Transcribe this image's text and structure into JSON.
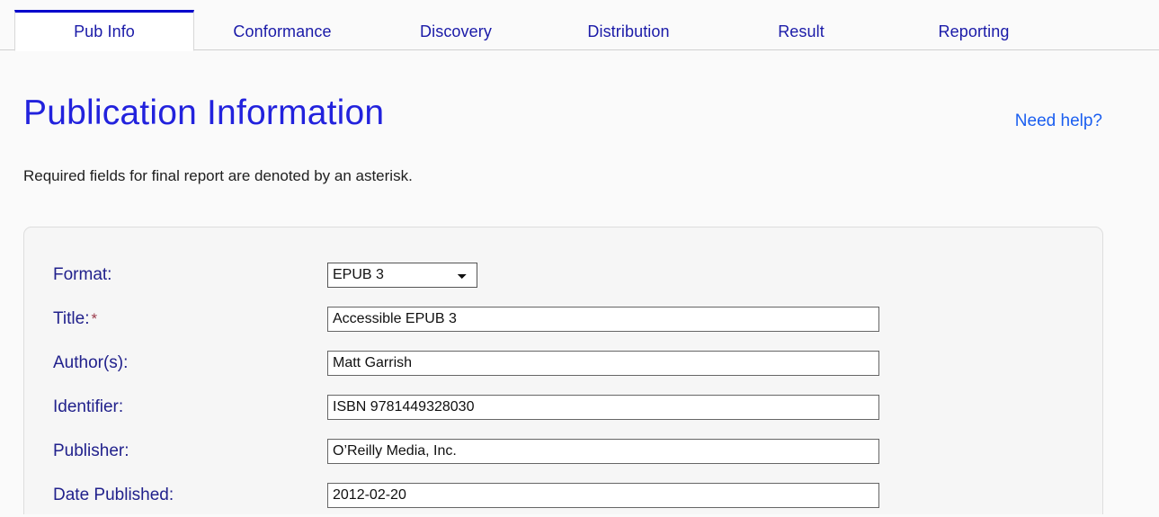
{
  "tabs": [
    {
      "label": "Pub Info",
      "active": true
    },
    {
      "label": "Conformance",
      "active": false
    },
    {
      "label": "Discovery",
      "active": false
    },
    {
      "label": "Distribution",
      "active": false
    },
    {
      "label": "Result",
      "active": false
    },
    {
      "label": "Reporting",
      "active": false
    }
  ],
  "header": {
    "title": "Publication Information",
    "help_link": "Need help?",
    "required_note": "Required fields for final report are denoted by an asterisk."
  },
  "form": {
    "fields": [
      {
        "label": "Format:",
        "type": "select",
        "value": "EPUB 3",
        "options": [
          "EPUB 3"
        ],
        "required": false,
        "star": ""
      },
      {
        "label": "Title:",
        "type": "text",
        "value": "Accessible EPUB 3",
        "placeholder": "",
        "required": true,
        "star": "*"
      },
      {
        "label": "Author(s):",
        "type": "text",
        "value": "Matt Garrish",
        "placeholder": "",
        "required": false,
        "star": ""
      },
      {
        "label": "Identifier:",
        "type": "text",
        "value": "ISBN 9781449328030",
        "placeholder": "",
        "required": false,
        "star": ""
      },
      {
        "label": "Publisher:",
        "type": "text",
        "value": "O’Reilly Media, Inc.",
        "placeholder": "",
        "required": false,
        "star": ""
      },
      {
        "label": "Date Published:",
        "type": "text",
        "value": "2012-02-20",
        "placeholder": "",
        "required": false,
        "star": ""
      }
    ]
  },
  "colors": {
    "tab_text": "#1a1aa8",
    "active_tab_border": "#0000cc",
    "title": "#2222dd",
    "link": "#1a5ef0",
    "label": "#21218c",
    "required_star": "#9b3b4b",
    "page_bg": "#fafafa",
    "form_bg": "#f6f6f6"
  }
}
